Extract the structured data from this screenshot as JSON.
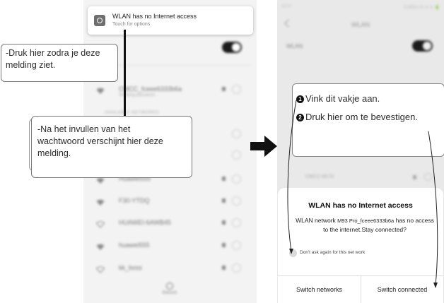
{
  "left_screen": {
    "notification": {
      "title": "WLAN has no Internet access",
      "subtitle": "Touch for options"
    },
    "toggle_on": true,
    "connected_network": {
      "name": "CMCC_fceee6333b6a",
      "status": "Verifying password..."
    },
    "section_label": "AVAILABLE NETWORKS",
    "networks": [
      "Huawei555",
      "F30-YTDQ",
      "HUAWEI-6AWB45",
      "huawei555",
      "kk_boss"
    ],
    "refresh_label": "Refresh"
  },
  "callouts": {
    "top": "-Druk hier zodra je deze\nmelding ziet.",
    "middle": "-Na het invullen van het\nwachtwoord verschijnt hier deze\nmelding.",
    "right_1": "Vink dit vakje aan.",
    "right_2": "Druk hier om te bevestigen.",
    "right_1_number": "1",
    "right_2_number": "2"
  },
  "right_screen": {
    "status_time": "10:37",
    "status_right": "3.2KB/s ⊘ ◷ ᯤ 🔋",
    "title": "WLAN",
    "wlan_label": "WLAN",
    "toggle_on": true,
    "visible_network": "CMCC-6K74",
    "dialog": {
      "title": "WLAN has no Internet access",
      "message_prefix": "WLAN network ",
      "network_name": "M93 Pro_fceee6333b6a",
      "message_suffix": " has no access to the internet.Stay connected?",
      "checkbox_label": "Don't ask again for this net work",
      "checkbox_checked": false,
      "button_left": "Switch networks",
      "button_right": "Switch connected"
    }
  },
  "colors": {
    "arrow": "#111111",
    "callout_border": "#777777",
    "toggle": "#1b1b1b"
  }
}
